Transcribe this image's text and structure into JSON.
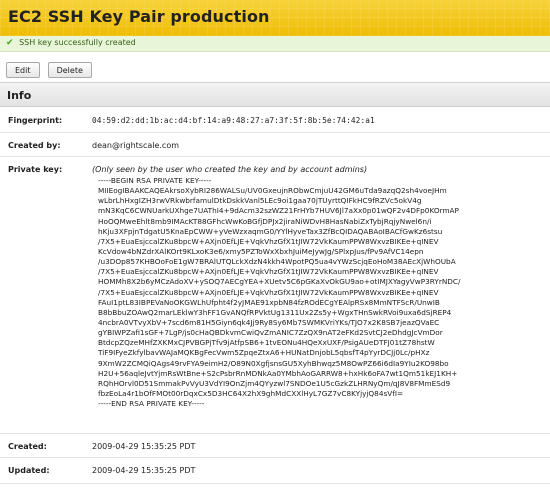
{
  "header": {
    "title": "EC2 SSH Key Pair production"
  },
  "flash": {
    "message": "SSH key successfully created",
    "icon": "check-icon"
  },
  "toolbar": {
    "edit_label": "Edit",
    "delete_label": "Delete"
  },
  "section": {
    "title": "Info"
  },
  "fields": {
    "fingerprint": {
      "label": "Fingerprint:",
      "value": "04:59:d2:dd:1b:ac:d4:bf:14:a9:48:27:a7:3f:5f:8b:5e:74:42:a1"
    },
    "created_by": {
      "label": "Created by:",
      "value": "dean@rightscale.com"
    },
    "private_key": {
      "label": "Private key:",
      "note": "(Only seen by the user who created the key and by account admins)",
      "lines": [
        "-----BEGIN RSA PRIVATE KEY-----",
        "MIIEogIBAAKCAQEAkrsoXybRI286WALSu/UV0GxeujnRObwCmjuU42GM6uTda9azqQ2sh4voeJHm",
        "wLbrLhHxgIZH3rwVRkwbrfamulDtkDskkVanl5LEc9oi1gaa70jTUyrttQIFkHC9fRZVc5okV4g",
        "mN3KqC6CWNUarkUXhge7UAThI4+9dAcm32szWZ21FrHYb7HUV6Jl7aXx0p01wQF2v4DFp0KOrmAP",
        "HoOQMweEhlt8mb9IMAcKT88GFhcWwKoBGfjDPJx2jiraNiWDvH8HasNabiZxTybjRqjyNwel6n/i",
        "hKju3XFpjnTdgatU5KnaEpCWW+yVeWzxaqmG0/YYlHyveTax3ZfBcQIDAQABAoIBACfGwKz6stsu",
        "/7X5+EuaEsjccalZKu8bpcW+AXjn0EfLJE+VqkVhzGfX1tJIW72VkKaumPPW8WxvzBIKEe+qINEV",
        "KcVdow4bNZdrXAlKOrt9KLxoK3e6/xmy5PZToWxXbxhJuiMeJywJg/SPlxpJus/fPv9AfVC14epn",
        "/u3DOp857KHBOoFoE1gW7BRAlUTQLckXdzN4kkh4WpotPQ5ua4vYWzScjqEoHoM38AEcXjWhOUbA",
        "/7X5+EuaEsjccalZKu8bpcW+AXjn0EfLJE+VqkVhzGfX1tJIW72VkKaumPPW8WxvzBIKEe+qINEV",
        "HOMMh8X2b6yMCzAdoXV+ySOQ7AECgYEA+XUetv5C6pGKaXvOkGU9ao+otIMJXYagyVwP3RYrNDC/",
        "/7X5+EuaEsjccalZKu8bpcW+AXjn0EfLJE+VqkVhzGfX1tJIW72VkKaumPPW8WxvzBIKEe+qINEV",
        "FAuI1ptL83IBPEVaNoOKGWLhUfpht4f2yJMAE91xpbN84fzROdECgYEAlpRSx8MmNTFScR/UnwIB",
        "B8bBbuZOAwQ2marLEklwY3hFF1GvANQfRPVktUg1311Ux2Zs5y+WgxTHnSwkRVoi9uxa6dSjREP4",
        "4ncbrA0VTvyXbV+7scd6m81H5Giyn6qk4Jj9Ry8Sy6Mb7SWMKVriYKs/TJO7x2K8SB7jeazQVaEC",
        "gYBIWPZafi1sGF+7LgP/js0cHaQBDkvmCwiQvZmANIC7ZzQX9nAT2eFKd2SvtCJ2eDhdgJcVmDor",
        "BtdcpZQzeMHfZXKMxCJPVBGPjTfv9jAtfpSB6+1tvEONu4HQeXxUXF/PsigAUeDTFJ01tZ78hstW",
        "TiF9IFyeZkfylbavWAJaMQKBgFecVwm5ZpqeZtxA6+HUNatDnjobL5qbsfT4pYyrDCJj0Lc/pHXz",
        "9XmW2ZCMQiQAgs49rvFYA9eimH2/O89N0XgfjsnsGU5XyhBhwqz5M8OwPZ66i6dIa9YIu2KO98bo",
        "H2U+56aqleJvtYjmRsWtBne+S2cPsbrRnMDNkAa0YMbhAoGARRW8+hxHk6oFA7wt1Qm51kEJ1KH+",
        "RQhHOrvl0D51SmmakPvVyU3VdYI9OnZjm4QYyzwl7SNDOe1U5cGzkZLHRNyQm/qJ8V8FMmESd9",
        "fbzEoLa4r1bOfFMOt00rDqxCx5D3HC64X2hX9ghMdCXXlHyL7GZ7vC8KYjyjQ84sVfI=",
        "-----END RSA PRIVATE KEY-----"
      ]
    },
    "created": {
      "label": "Created:",
      "value": "2009-04-29 15:35:25 PDT"
    },
    "updated": {
      "label": "Updated:",
      "value": "2009-04-29 15:35:25 PDT"
    }
  },
  "colors": {
    "title_bar": "#f3c40e",
    "flash_bg": "#e9f5d8",
    "flash_text": "#355f18"
  }
}
